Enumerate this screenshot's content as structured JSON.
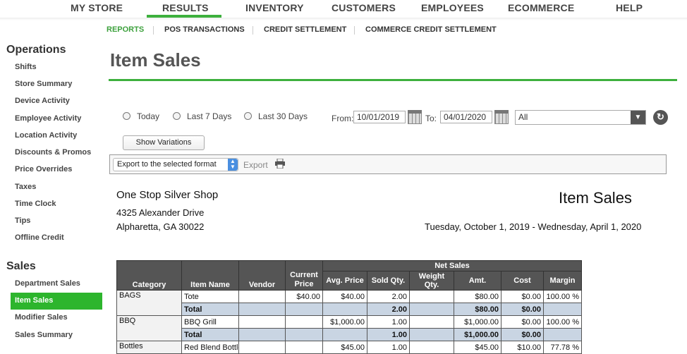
{
  "top_nav": {
    "items": [
      "MY STORE",
      "RESULTS",
      "INVENTORY",
      "CUSTOMERS",
      "EMPLOYEES",
      "ECOMMERCE",
      "HELP"
    ],
    "active": "RESULTS"
  },
  "sub_nav": {
    "items": [
      "REPORTS",
      "POS TRANSACTIONS",
      "CREDIT SETTLEMENT",
      "COMMERCE CREDIT SETTLEMENT"
    ],
    "active": "REPORTS"
  },
  "sidebar": {
    "operations_heading": "Operations",
    "operations_items": [
      "Shifts",
      "Store Summary",
      "Device Activity",
      "Employee Activity",
      "Location Activity",
      "Discounts & Promos",
      "Price Overrides",
      "Taxes",
      "Time Clock",
      "Tips",
      "Offline Credit"
    ],
    "sales_heading": "Sales",
    "sales_items": [
      "Department Sales",
      "Item Sales",
      "Modifier Sales",
      "Sales Summary"
    ],
    "active_item": "Item Sales"
  },
  "page": {
    "title": "Item Sales"
  },
  "filters": {
    "radios": [
      "Today",
      "Last 7 Days",
      "Last 30 Days"
    ],
    "from_label": "From:",
    "from_value": "10/01/2019",
    "to_label": "To:",
    "to_value": "04/01/2020",
    "select_value": "All",
    "show_variations": "Show Variations"
  },
  "export_bar": {
    "format_select": "Export to the selected format",
    "export_label": "Export"
  },
  "report": {
    "store_name": "One Stop Silver Shop",
    "address_line1": "4325 Alexander Drive",
    "address_line2": "Alpharetta, GA 30022",
    "title": "Item Sales",
    "date_range": "Tuesday, October 1, 2019 - Wednesday, April 1, 2020",
    "headers": {
      "category": "Category",
      "item_name": "Item Name",
      "vendor": "Vendor",
      "current_price": "Current Price",
      "net_sales": "Net Sales",
      "avg_price": "Avg. Price",
      "sold_qty": "Sold Qty.",
      "weight_qty": "Weight Qty.",
      "amt": "Amt.",
      "cost": "Cost",
      "margin": "Margin"
    },
    "groups": [
      {
        "category": "BAGS",
        "item": {
          "name": "Tote",
          "vendor": "",
          "current_price": "$40.00",
          "avg_price": "$40.00",
          "sold_qty": "2.00",
          "weight_qty": "",
          "amt": "$80.00",
          "cost": "$0.00",
          "margin": "100.00 %"
        },
        "total": {
          "label": "Total",
          "sold_qty": "2.00",
          "amt": "$80.00",
          "cost": "$0.00"
        }
      },
      {
        "category": "BBQ",
        "item": {
          "name": "BBQ Grill",
          "vendor": "",
          "current_price": "",
          "avg_price": "$1,000.00",
          "sold_qty": "1.00",
          "weight_qty": "",
          "amt": "$1,000.00",
          "cost": "$0.00",
          "margin": "100.00 %"
        },
        "total": {
          "label": "Total",
          "sold_qty": "1.00",
          "amt": "$1,000.00",
          "cost": "$0.00"
        }
      },
      {
        "category": "Bottles",
        "item": {
          "name": "Red Blend Bottle",
          "vendor": "",
          "current_price": "",
          "avg_price": "$45.00",
          "sold_qty": "1.00",
          "weight_qty": "",
          "amt": "$45.00",
          "cost": "$10.00",
          "margin": "77.78 %"
        }
      }
    ]
  }
}
